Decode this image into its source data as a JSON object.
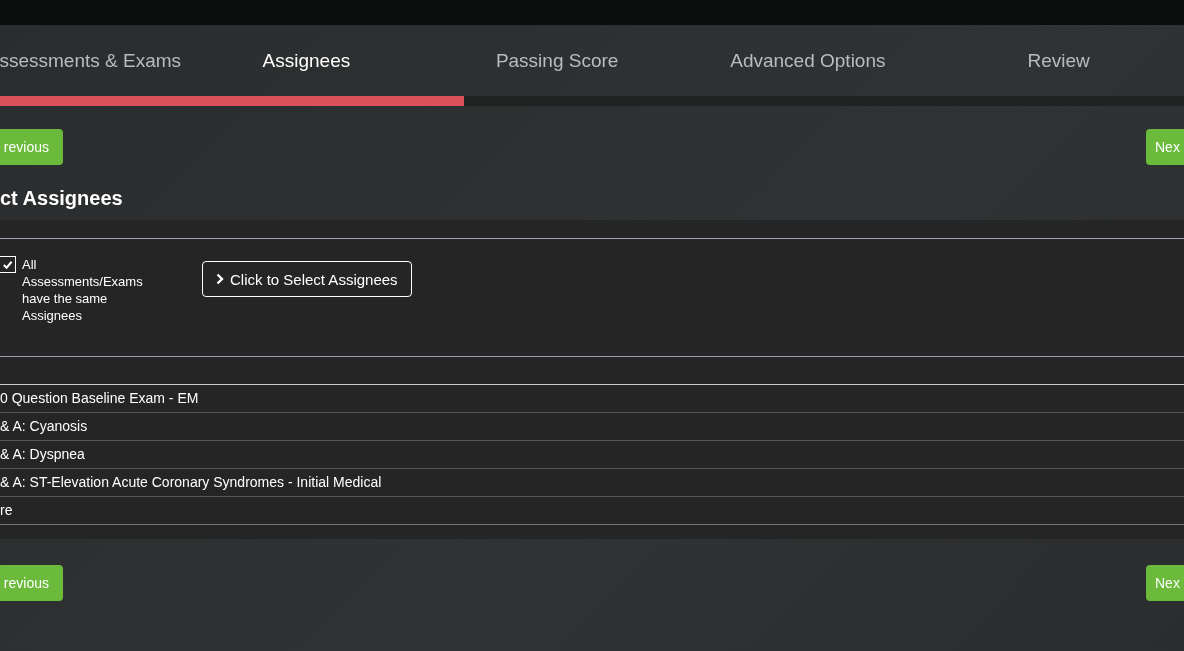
{
  "tabs": [
    {
      "label": "ssessments & Exams",
      "selected": false
    },
    {
      "label": "Assignees",
      "selected": true
    },
    {
      "label": "Passing Score",
      "selected": false
    },
    {
      "label": "Advanced Options",
      "selected": false
    },
    {
      "label": "Review",
      "selected": false
    }
  ],
  "progress": {
    "level": 0.392
  },
  "nav_top": {
    "previous": "revious",
    "next": "Nex"
  },
  "heading": "ct Assignees",
  "same_assignees": {
    "checked": true,
    "label": "All Assessments/Exams have the same Assignees"
  },
  "select_button": "Click to Select Assignees",
  "exams": [
    "0 Question Baseline Exam - EM",
    "& A: Cyanosis",
    "& A: Dyspnea",
    "& A: ST-Elevation Acute Coronary Syndromes - Initial Medical",
    "re"
  ],
  "nav_bottom": {
    "previous": "revious",
    "next": "Nex"
  }
}
